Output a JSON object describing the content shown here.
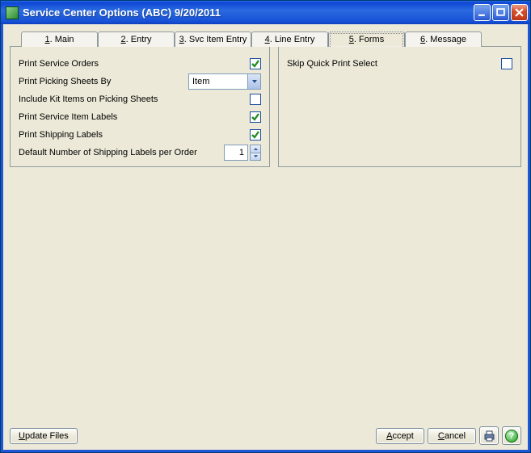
{
  "title": "Service Center Options (ABC) 9/20/2011",
  "tabs": [
    {
      "num": "1",
      "label": "Main"
    },
    {
      "num": "2",
      "label": "Entry"
    },
    {
      "num": "3",
      "label": "Svc Item Entry"
    },
    {
      "num": "4",
      "label": "Line Entry"
    },
    {
      "num": "5",
      "label": "Forms"
    },
    {
      "num": "6",
      "label": "Message"
    }
  ],
  "left": {
    "print_service_orders": {
      "label": "Print Service Orders",
      "checked": true
    },
    "print_picking_sheets_by": {
      "label": "Print Picking Sheets By",
      "value": "Item"
    },
    "include_kit": {
      "label": "Include Kit Items on Picking Sheets",
      "checked": false
    },
    "print_service_item_labels": {
      "label": "Print Service Item Labels",
      "checked": true
    },
    "print_shipping_labels": {
      "label": "Print Shipping Labels",
      "checked": true
    },
    "default_shipping_labels": {
      "label": "Default Number of Shipping Labels per Order",
      "value": "1"
    }
  },
  "right": {
    "skip_quick_print": {
      "label": "Skip Quick Print Select",
      "checked": false
    }
  },
  "buttons": {
    "update_files": "pdate Files",
    "update_files_ul": "U",
    "accept": "ccept",
    "accept_ul": "A",
    "cancel": "ancel",
    "cancel_ul": "C"
  }
}
